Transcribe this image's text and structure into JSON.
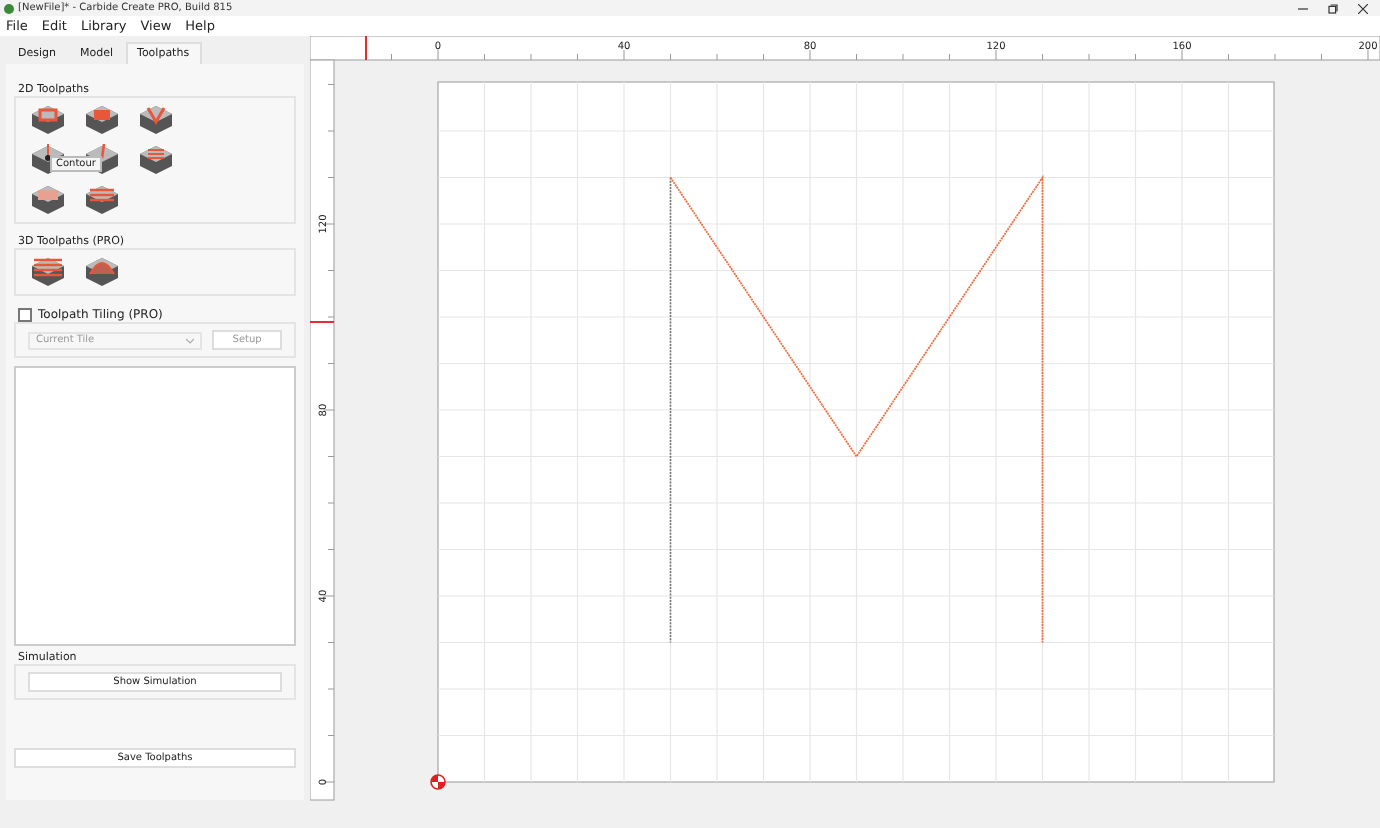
{
  "window": {
    "title": "[NewFile]* - Carbide Create PRO, Build 815"
  },
  "menu": [
    "File",
    "Edit",
    "Library",
    "View",
    "Help"
  ],
  "tabs": [
    {
      "label": "Design",
      "selected": false
    },
    {
      "label": "Model",
      "selected": false
    },
    {
      "label": "Toolpaths",
      "selected": true
    }
  ],
  "toolpaths_2d": {
    "title": "2D Toolpaths",
    "tooltip": "Contour"
  },
  "toolpaths_3d": {
    "title": "3D Toolpaths (PRO)"
  },
  "tiling": {
    "label": "Toolpath Tiling (PRO)",
    "checked": false,
    "tile_select": {
      "placeholder": "Current Tile",
      "disabled": true
    },
    "setup_button": {
      "label": "Setup",
      "disabled": true
    }
  },
  "simulation": {
    "title": "Simulation",
    "button": "Show Simulation"
  },
  "save_button": "Save Toolpaths",
  "rulers": {
    "x_labels": [
      "0",
      "40",
      "80",
      "120",
      "160",
      "200"
    ],
    "y_labels": [
      "0",
      "40",
      "80",
      "120"
    ]
  }
}
